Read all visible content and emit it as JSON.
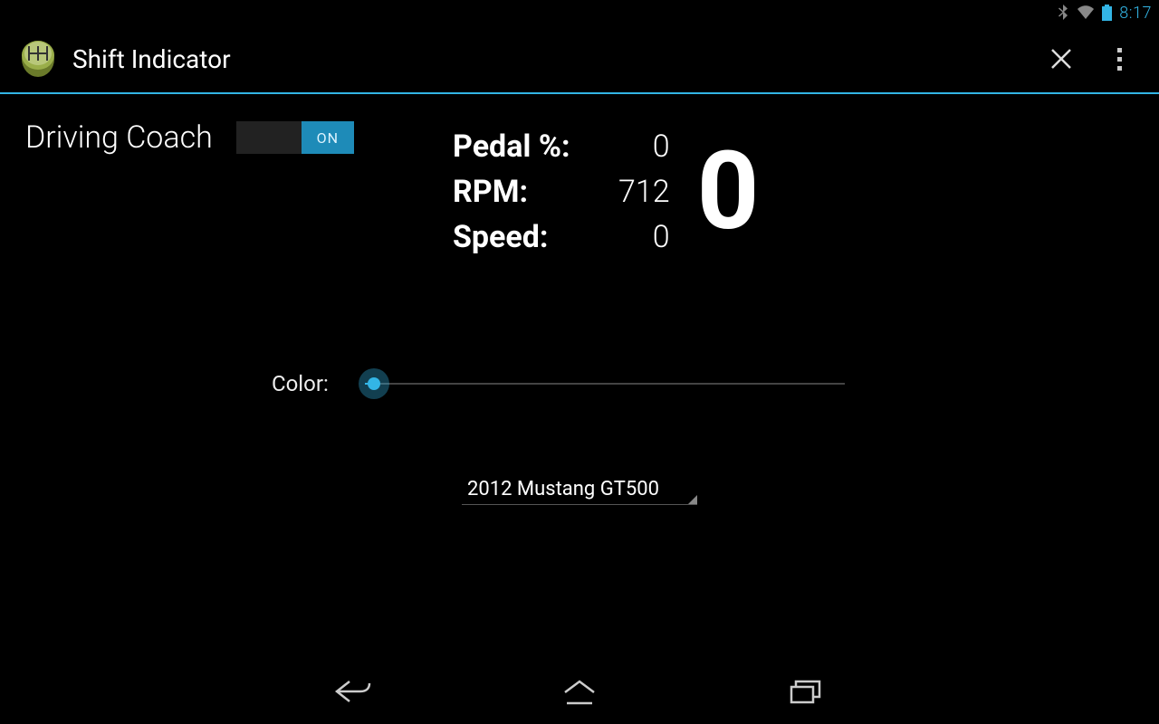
{
  "status": {
    "time": "8:17"
  },
  "header": {
    "title": "Shift Indicator"
  },
  "drivingCoach": {
    "label": "Driving Coach",
    "switch_state": "ON"
  },
  "gauges": {
    "pedal_label": "Pedal %:",
    "pedal_value": "0",
    "rpm_label": "RPM:",
    "rpm_value": "712",
    "speed_label": "Speed:",
    "speed_value": "0",
    "gear": "0"
  },
  "colorRow": {
    "label": "Color:"
  },
  "vehicle": {
    "selected": "2012 Mustang GT500"
  },
  "colors": {
    "accent": "#33b5e5"
  }
}
